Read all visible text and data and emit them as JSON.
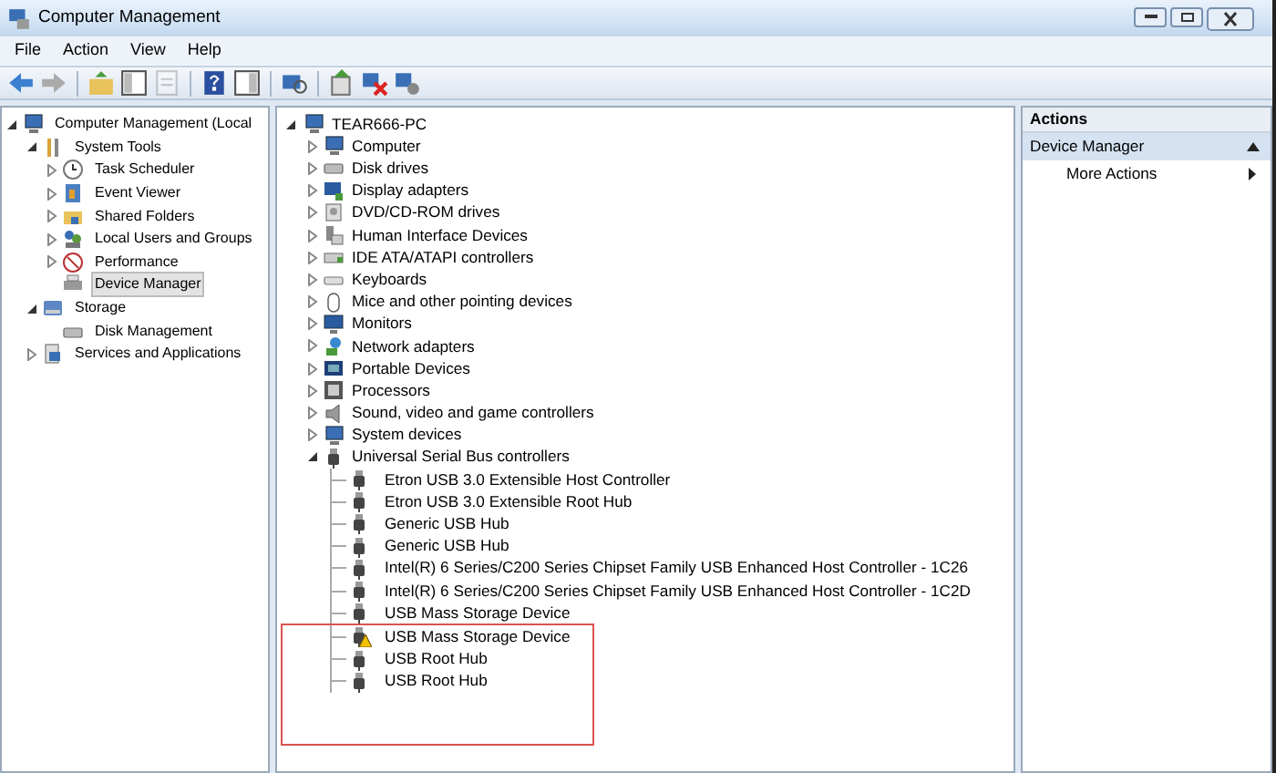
{
  "window": {
    "title": "Computer Management"
  },
  "menu": [
    "File",
    "Action",
    "View",
    "Help"
  ],
  "toolbar": [
    {
      "kind": "back",
      "disabled": false
    },
    {
      "kind": "forward",
      "disabled": true
    },
    {
      "kind": "sep"
    },
    {
      "kind": "folder-up",
      "disabled": false
    },
    {
      "kind": "console-tree",
      "disabled": false
    },
    {
      "kind": "properties",
      "disabled": true
    },
    {
      "kind": "sep"
    },
    {
      "kind": "help",
      "disabled": false
    },
    {
      "kind": "action-pane",
      "disabled": false
    },
    {
      "kind": "sep"
    },
    {
      "kind": "scan",
      "disabled": false
    },
    {
      "kind": "sep"
    },
    {
      "kind": "update",
      "disabled": false
    },
    {
      "kind": "uninstall",
      "disabled": false
    },
    {
      "kind": "disable",
      "disabled": false
    }
  ],
  "sidebar": {
    "items": [
      {
        "label": "Computer Management (Local",
        "kind": "computer",
        "expanded": true,
        "selected": false,
        "children": [
          {
            "label": "System Tools",
            "kind": "tools",
            "expanded": true,
            "selected": false,
            "children": [
              {
                "label": "Task Scheduler",
                "kind": "clock",
                "expanded": false,
                "selected": false
              },
              {
                "label": "Event Viewer",
                "kind": "event",
                "expanded": false,
                "selected": false
              },
              {
                "label": "Shared Folders",
                "kind": "folder",
                "expanded": false,
                "selected": false
              },
              {
                "label": "Local Users and Groups",
                "kind": "users",
                "expanded": false,
                "selected": false
              },
              {
                "label": "Performance",
                "kind": "performance",
                "expanded": false,
                "selected": false
              },
              {
                "label": "Device Manager",
                "kind": "device",
                "selected": true
              }
            ]
          },
          {
            "label": "Storage",
            "kind": "storage",
            "expanded": true,
            "selected": false,
            "children": [
              {
                "label": "Disk Management",
                "kind": "disk",
                "selected": false
              }
            ]
          },
          {
            "label": "Services and Applications",
            "kind": "services",
            "expanded": false,
            "selected": false
          }
        ]
      }
    ]
  },
  "devices": {
    "root": "TEAR666-PC",
    "categories": [
      {
        "label": "Computer",
        "kind": "computer",
        "expanded": false
      },
      {
        "label": "Disk drives",
        "kind": "disk",
        "expanded": false
      },
      {
        "label": "Display adapters",
        "kind": "display",
        "expanded": false
      },
      {
        "label": "DVD/CD-ROM drives",
        "kind": "dvd",
        "expanded": false
      },
      {
        "label": "Human Interface Devices",
        "kind": "hid",
        "expanded": false
      },
      {
        "label": "IDE ATA/ATAPI controllers",
        "kind": "ide",
        "expanded": false
      },
      {
        "label": "Keyboards",
        "kind": "keyboard",
        "expanded": false
      },
      {
        "label": "Mice and other pointing devices",
        "kind": "mouse",
        "expanded": false
      },
      {
        "label": "Monitors",
        "kind": "monitor",
        "expanded": false
      },
      {
        "label": "Network adapters",
        "kind": "network",
        "expanded": false
      },
      {
        "label": "Portable Devices",
        "kind": "portable",
        "expanded": false
      },
      {
        "label": "Processors",
        "kind": "processor",
        "expanded": false
      },
      {
        "label": "Sound, video and game controllers",
        "kind": "sound",
        "expanded": false
      },
      {
        "label": "System devices",
        "kind": "computer",
        "expanded": false
      },
      {
        "label": "Universal Serial Bus controllers",
        "kind": "usb",
        "expanded": true,
        "children": [
          {
            "label": "Etron USB 3.0 Extensible Host Controller",
            "warning": false,
            "highlighted": false
          },
          {
            "label": "Etron USB 3.0 Extensible Root Hub",
            "warning": false,
            "highlighted": false
          },
          {
            "label": "Generic USB Hub",
            "warning": false,
            "highlighted": false
          },
          {
            "label": "Generic USB Hub",
            "warning": false,
            "highlighted": false
          },
          {
            "label": "Intel(R) 6 Series/C200 Series Chipset Family USB Enhanced Host Controller - 1C26",
            "warning": false,
            "highlighted": false
          },
          {
            "label": "Intel(R) 6 Series/C200 Series Chipset Family USB Enhanced Host Controller - 1C2D",
            "warning": false,
            "highlighted": false
          },
          {
            "label": "USB Mass Storage Device",
            "warning": false,
            "highlighted": false
          },
          {
            "label": "USB Mass Storage Device",
            "warning": true,
            "highlighted": true
          },
          {
            "label": "USB Root Hub",
            "warning": false,
            "highlighted": true
          },
          {
            "label": "USB Root Hub",
            "warning": false,
            "highlighted": true
          }
        ]
      }
    ]
  },
  "actions": {
    "title": "Actions",
    "section": {
      "label": "Device Manager",
      "expanded": true
    },
    "items": [
      {
        "label": "More Actions"
      }
    ]
  }
}
